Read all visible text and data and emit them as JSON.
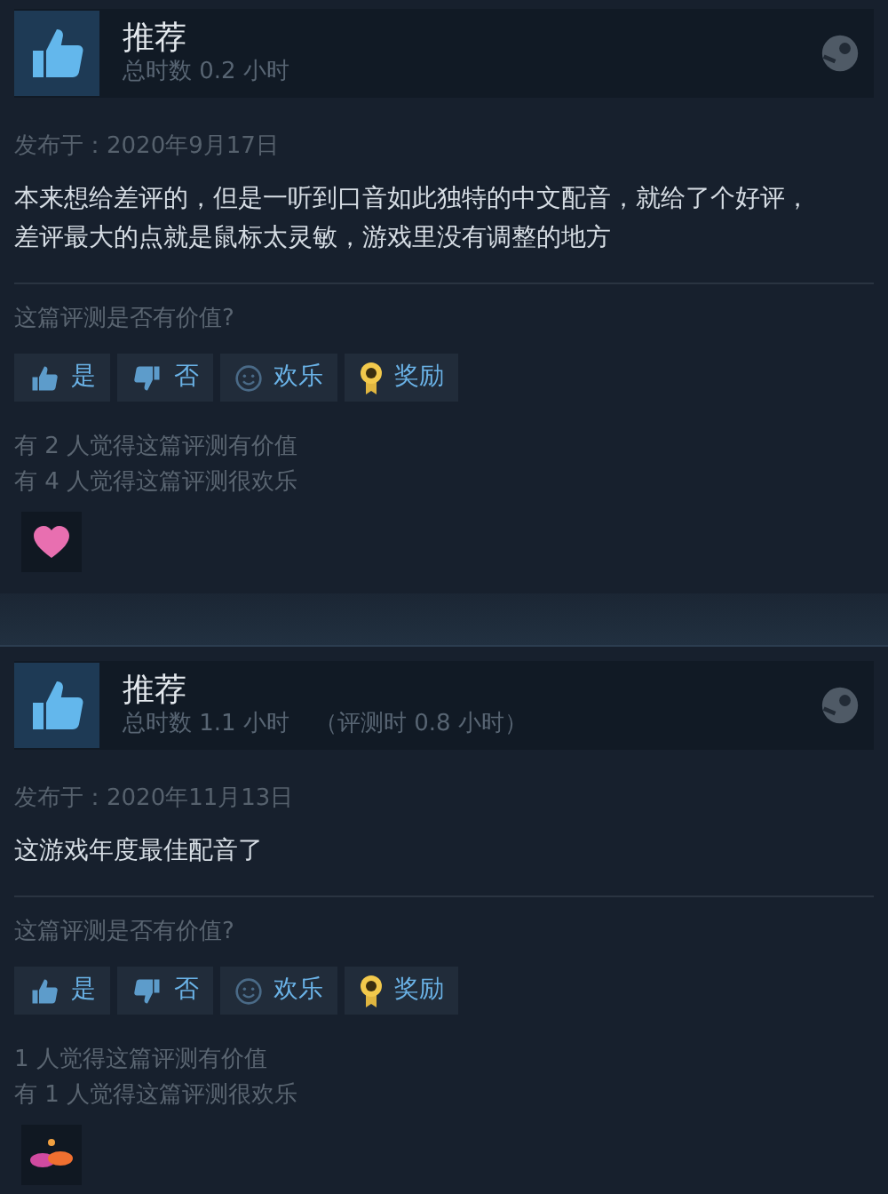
{
  "reviews": [
    {
      "verdict": "推荐",
      "hours": "总时数 0.2 小时",
      "posted": "发布于：2020年9月17日",
      "body": "本来想给差评的，但是一听到口音如此独特的中文配音，就给了个好评，差评最大的点就是鼠标太灵敏，游戏里没有调整的地方",
      "question": "这篇评测是否有价值?",
      "buttons": [
        {
          "kind": "yes",
          "label": "是"
        },
        {
          "kind": "no",
          "label": "否"
        },
        {
          "kind": "funny",
          "label": "欢乐"
        },
        {
          "kind": "award",
          "label": "奖励"
        }
      ],
      "counts": [
        "有 2 人觉得这篇评测有价值",
        "有 4 人觉得这篇评测很欢乐"
      ],
      "awards": [
        {
          "kind": "heart"
        }
      ]
    },
    {
      "verdict": "推荐",
      "hours": "总时数 1.1 小时",
      "review_hours": "（评测时 0.8 小时）",
      "posted": "发布于：2020年11月13日",
      "body": "这游戏年度最佳配音了",
      "question": "这篇评测是否有价值?",
      "buttons": [
        {
          "kind": "yes",
          "label": "是"
        },
        {
          "kind": "no",
          "label": "否"
        },
        {
          "kind": "funny",
          "label": "欢乐"
        },
        {
          "kind": "award",
          "label": "奖励"
        }
      ],
      "counts": [
        "1 人觉得这篇评测有价值",
        "有 1 人觉得这篇评测很欢乐"
      ],
      "awards": [
        {
          "kind": "clouds"
        }
      ]
    }
  ]
}
